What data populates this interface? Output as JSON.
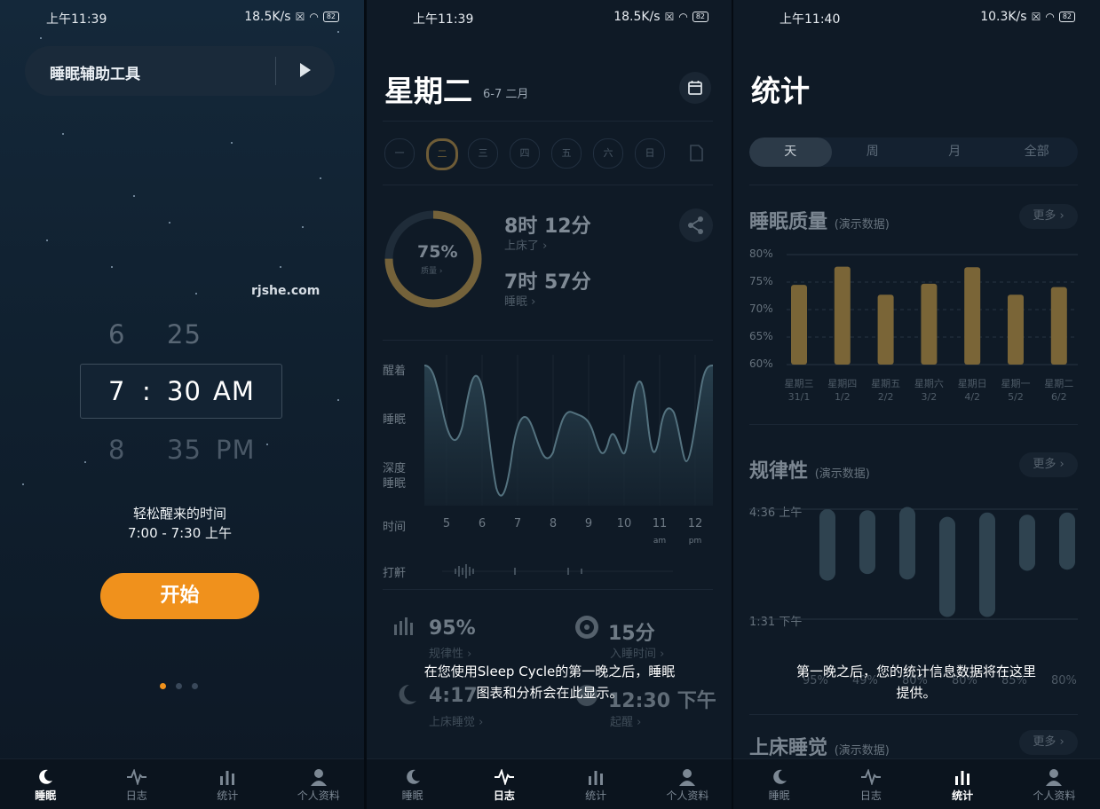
{
  "status_bars": [
    {
      "time": "上午11:39",
      "net": "18.5K/s",
      "battery": "82"
    },
    {
      "time": "上午11:39",
      "net": "18.5K/s",
      "battery": "82"
    },
    {
      "time": "上午11:40",
      "net": "10.3K/s",
      "battery": "82"
    }
  ],
  "sleep_screen": {
    "tool_label": "睡眠辅助工具",
    "watermark": "rjshe.com",
    "picker": {
      "prev": {
        "hour": "6",
        "minute": "25",
        "ampm": ""
      },
      "current": {
        "hour": "7",
        "sep": ":",
        "minute": "30",
        "ampm": "AM"
      },
      "next": {
        "hour": "8",
        "minute": "35",
        "ampm": "PM"
      }
    },
    "easy_wake_label": "轻松醒来的时间",
    "easy_wake_range": "7:00 - 7:30 上午",
    "start_button": "开始"
  },
  "journal_screen": {
    "day": "星期二",
    "date": "6-7 二月",
    "week_days": [
      "一",
      "二",
      "三",
      "四",
      "五",
      "六",
      "日"
    ],
    "quality_percent": "75%",
    "quality_label": "质量 ›",
    "in_bed_value": "8时 12分",
    "in_bed_label": "上床了 ›",
    "asleep_value": "7时 57分",
    "asleep_label": "睡眠 ›",
    "graph_labels": {
      "awake": "醒着",
      "sleep": "睡眠",
      "deep1": "深度",
      "deep2": "睡眠",
      "time": "时间",
      "snore": "打鼾"
    },
    "hours": [
      "5",
      "6",
      "7",
      "8",
      "9",
      "10",
      "11",
      "12"
    ],
    "hour_subs": {
      "11": "am",
      "12": "pm"
    },
    "metrics": [
      {
        "value": "95%",
        "label": "规律性 ›"
      },
      {
        "value": "15分",
        "label": "入睡时间 ›"
      },
      {
        "value": "4:17",
        "label": "上床睡觉 ›"
      },
      {
        "value": "12:30 下午",
        "label": "起醒 ›"
      }
    ],
    "overlay_line1": "在您使用Sleep Cycle的第一晚之后，睡眠",
    "overlay_line2": "图表和分析会在此显示。"
  },
  "stats_screen": {
    "title": "统计",
    "segments": [
      "天",
      "周",
      "月",
      "全部"
    ],
    "active_segment": 0,
    "quality_title": "睡眠质量",
    "demo_tag": "(演示数据)",
    "more": "更多 ›",
    "regularity_title": "规律性",
    "bedtime_title": "上床睡觉",
    "reg_axis": [
      "4:36 上午",
      "1:31 下午"
    ],
    "reg_percents": [
      "95%",
      "49%",
      "80%",
      "80%",
      "85%",
      "80%"
    ],
    "overlay_line1": "第一晚之后，您的统计信息数据将在这里",
    "overlay_line2": "提供。"
  },
  "nav": {
    "items": [
      "睡眠",
      "日志",
      "统计",
      "个人资料"
    ]
  },
  "chart_data": [
    {
      "type": "bar",
      "title": "睡眠质量",
      "categories": [
        "星期三 31/1",
        "星期四 1/2",
        "星期五 2/2",
        "星期六 3/2",
        "星期日 4/2",
        "星期一 5/2",
        "星期二 6/2"
      ],
      "category_days": [
        "星期三",
        "星期四",
        "星期五",
        "星期六",
        "星期日",
        "星期一",
        "星期二"
      ],
      "category_dates": [
        "31/1",
        "1/2",
        "2/2",
        "3/2",
        "4/2",
        "5/2",
        "6/2"
      ],
      "values": [
        74.5,
        77.8,
        72.7,
        74.7,
        77.7,
        72.7,
        74.1
      ],
      "yticks": [
        "80%",
        "75%",
        "70%",
        "65%",
        "60%"
      ],
      "ylim": [
        60,
        80
      ],
      "color": "#7a6537"
    },
    {
      "type": "bar",
      "title": "规律性",
      "ranges": [
        [
          0,
          0.65
        ],
        [
          0.01,
          0.59
        ],
        [
          -0.02,
          0.64
        ],
        [
          0.07,
          0.98
        ],
        [
          0.03,
          0.98
        ],
        [
          0.05,
          0.56
        ],
        [
          0.03,
          0.55
        ]
      ],
      "color": "#2f4350"
    }
  ]
}
